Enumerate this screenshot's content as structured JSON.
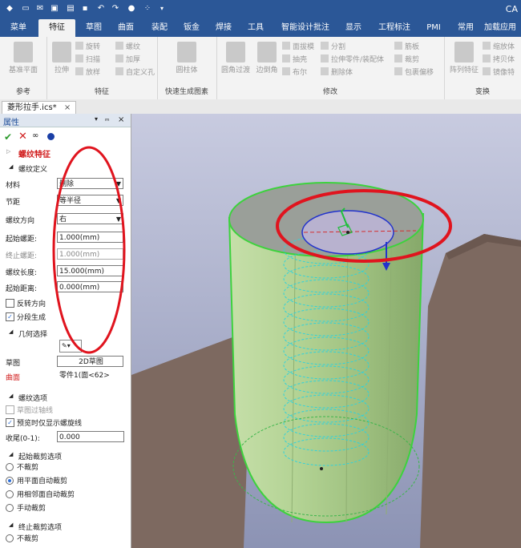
{
  "app": {
    "title_fragment": "CA"
  },
  "menu_tabs": [
    "菜单",
    "特征",
    "草图",
    "曲面",
    "装配",
    "钣金",
    "焊接",
    "工具",
    "智能设计批注",
    "显示",
    "工程标注",
    "PMI",
    "常用",
    "加载应用"
  ],
  "active_tab": "特征",
  "ribbon": {
    "groups": {
      "ref": "参考",
      "feature": "特征",
      "quick": "快速生成图素",
      "modify": "修改",
      "transform": "变换"
    },
    "buttons": {
      "base_sketch": "基准平面",
      "extrude": "拉伸",
      "revolve": "旋转",
      "sweep": "扫描",
      "loft": "放样",
      "thread": "螺纹",
      "thicken": "加厚",
      "custom_hole": "自定义孔",
      "cylinder": "圆柱体",
      "round_transition": "圆角过渡",
      "chamfer": "边倒角",
      "draft": "面拔模",
      "shell": "抽壳",
      "boolean": "布尔",
      "split": "分割",
      "stretch_part": "拉伸零件/装配体",
      "delete_body": "删除体",
      "rib": "筋板",
      "cut": "裁剪",
      "wrap_offset": "包裹偏移",
      "array": "阵列特征",
      "scale": "缩放体",
      "copy": "拷贝体",
      "mirror": "镜像特"
    }
  },
  "document_tab": "菱形拉手.ics*",
  "panel": {
    "title": "属性",
    "feature_name": "螺纹特征",
    "section_thread_def": "螺纹定义",
    "material_label": "材料",
    "material_value": "删除",
    "pitch_label": "节距",
    "pitch_value": "等半径",
    "direction_label": "螺纹方向",
    "direction_value": "右",
    "start_pitch_label": "起始螺距:",
    "start_pitch_value": "1.000(mm)",
    "end_pitch_label": "终止螺距:",
    "end_pitch_value": "1.000(mm)",
    "length_label": "螺纹长度:",
    "length_value": "15.000(mm)",
    "start_distance_label": "起始距离:",
    "start_distance_value": "0.000(mm)",
    "reverse_label": "反转方向",
    "segment_label": "分段生成",
    "section_geometry": "几何选择",
    "sketch_label": "草图",
    "sketch_value": "2D草图",
    "surface_label": "曲面",
    "surface_value": "零件1(面<62>",
    "section_thread_options": "螺纹选项",
    "sketch_axis_label": "草图过轴线",
    "preview_label": "预览时仅显示螺旋线",
    "tail_label": "收尾(0-1):",
    "tail_value": "0.000",
    "section_start_trim": "起始裁剪选项",
    "start_trim_options": [
      "不裁剪",
      "用平面自动裁剪",
      "用相邻面自动裁剪",
      "手动裁剪"
    ],
    "section_end_trim": "终止裁剪选项",
    "end_trim_options": [
      "不裁剪"
    ]
  },
  "colors": {
    "title_bar": "#2b5797",
    "annotation_red": "#e0141e",
    "cylinder_green": "#a9c98a",
    "helix_cyan": "#2fd2dc"
  }
}
